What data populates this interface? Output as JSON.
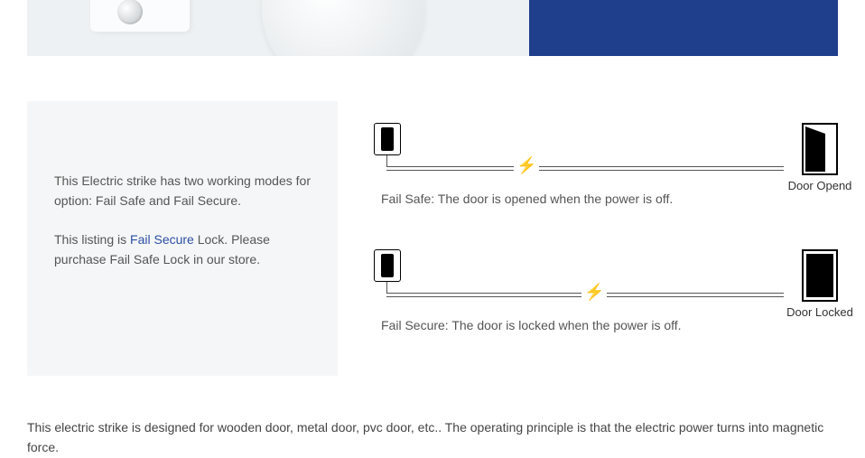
{
  "info": {
    "p1": "This Electric strike has two working modes for option: Fail Safe and Fail Secure.",
    "p2_a": "This listing is ",
    "p2_highlight": "Fail Secure",
    "p2_b": " Lock. Please purchase Fail Safe Lock in our store."
  },
  "diagrams": {
    "failsafe": {
      "caption": "Fail Safe: The door is opened when the power is off.",
      "door_label": "Door Opend"
    },
    "failsecure": {
      "caption": "Fail Secure: The door is locked when the power is off.",
      "door_label": "Door Locked"
    }
  },
  "bottom": "This electric strike is designed for wooden door, metal door, pvc door, etc.. The operating principle is that the electric power turns into magnetic force."
}
